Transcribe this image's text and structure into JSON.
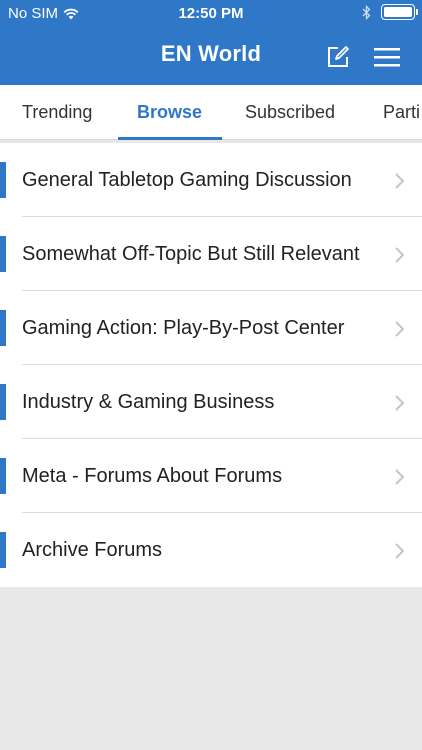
{
  "status_bar": {
    "carrier": "No SIM",
    "time": "12:50 PM"
  },
  "header": {
    "title": "EN World",
    "compose_icon": "compose-icon",
    "menu_icon": "hamburger-menu-icon"
  },
  "tabs": [
    {
      "label": "Trending"
    },
    {
      "label": "Browse",
      "active": true
    },
    {
      "label": "Subscribed"
    },
    {
      "label": "Parti"
    }
  ],
  "forums": [
    {
      "label": "General Tabletop Gaming Discussion"
    },
    {
      "label": "Somewhat Off-Topic But Still Relevant"
    },
    {
      "label": "Gaming Action: Play-By-Post Center"
    },
    {
      "label": "Industry & Gaming Business"
    },
    {
      "label": "Meta - Forums About Forums"
    },
    {
      "label": "Archive Forums"
    }
  ],
  "colors": {
    "accent": "#2f77c7",
    "background": "#e7e7e7"
  }
}
